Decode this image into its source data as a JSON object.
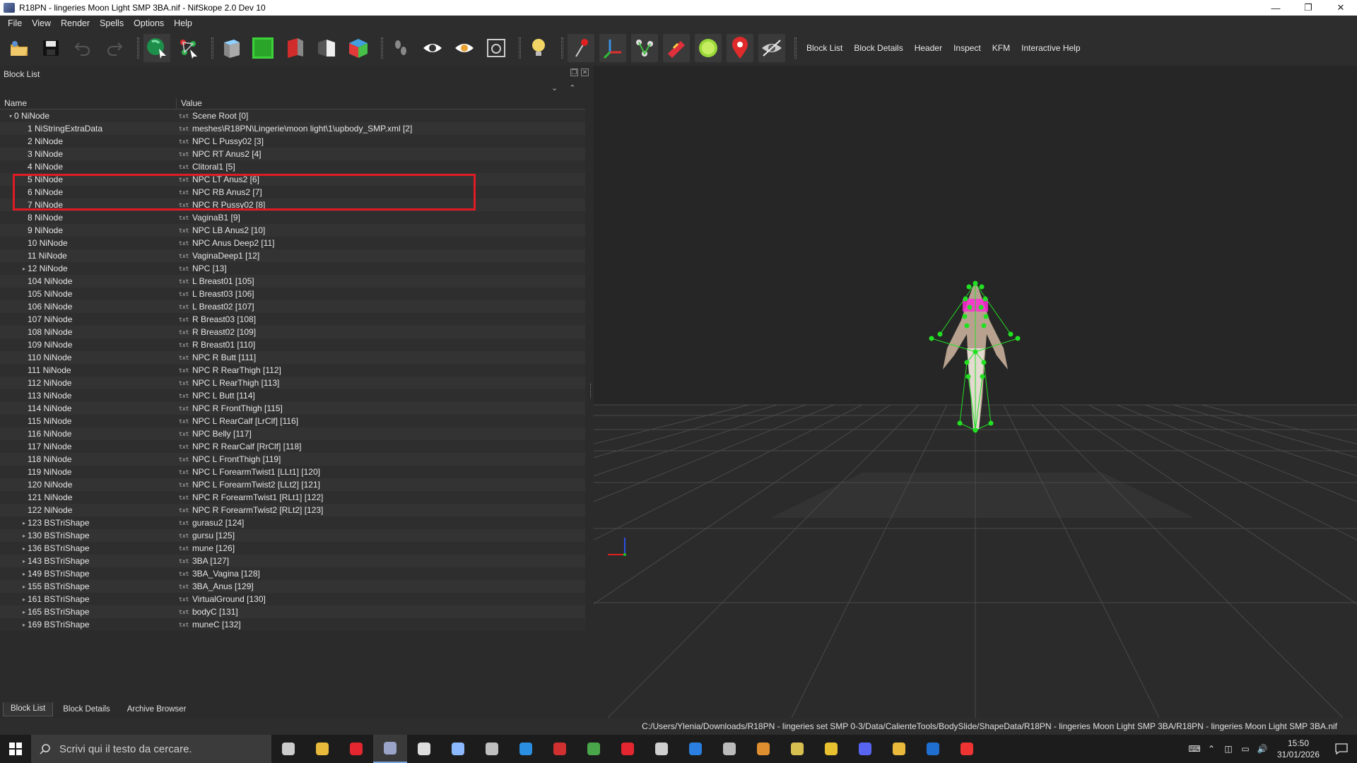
{
  "window": {
    "title": "R18PN - lingeries Moon Light SMP 3BA.nif - NifSkope 2.0 Dev 10",
    "minimize": "—",
    "maximize": "❐",
    "close": "✕"
  },
  "menu": [
    "File",
    "View",
    "Render",
    "Spells",
    "Options",
    "Help"
  ],
  "toolbar": {
    "icons": [
      "load-icon",
      "save-icon",
      "undo-icon",
      "redo-icon",
      "select-object-icon",
      "select-vertex-icon",
      "view-top-icon",
      "view-front-icon",
      "view-side-icon",
      "view-user-icon",
      "view-walk-icon",
      "footprint-icon",
      "show-eye-icon",
      "show-hidden-icon",
      "screenshot-icon",
      "lighting-bulb-icon",
      "show-markers-icon",
      "show-axes-icon",
      "show-nodes-icon",
      "show-constraints-icon",
      "show-havok-icon",
      "show-furniture-icon",
      "show-hidden-objects-icon"
    ],
    "tabs": [
      "Block List",
      "Block Details",
      "Header",
      "Inspect",
      "KFM",
      "Interactive Help"
    ]
  },
  "blocklist": {
    "title": "Block List",
    "columns": {
      "name": "Name",
      "value": "Value"
    },
    "rows": [
      {
        "name": "0 NiNode",
        "value": "Scene Root [0]",
        "expander": "▾",
        "indent": 0
      },
      {
        "name": "1 NiStringExtraData",
        "value": "meshes\\R18PN\\Lingerie\\moon light\\1\\upbody_SMP.xml [2]",
        "expander": "",
        "indent": 1
      },
      {
        "name": "2 NiNode",
        "value": "NPC L Pussy02 [3]",
        "expander": "",
        "indent": 1
      },
      {
        "name": "3 NiNode",
        "value": "NPC RT Anus2 [4]",
        "expander": "",
        "indent": 1
      },
      {
        "name": "4 NiNode",
        "value": "Clitoral1 [5]",
        "expander": "",
        "indent": 1
      },
      {
        "name": "5 NiNode",
        "value": "NPC LT Anus2 [6]",
        "expander": "",
        "indent": 1
      },
      {
        "name": "6 NiNode",
        "value": "NPC RB Anus2 [7]",
        "expander": "",
        "indent": 1
      },
      {
        "name": "7 NiNode",
        "value": "NPC R Pussy02 [8]",
        "expander": "",
        "indent": 1
      },
      {
        "name": "8 NiNode",
        "value": "VaginaB1 [9]",
        "expander": "",
        "indent": 1
      },
      {
        "name": "9 NiNode",
        "value": "NPC LB Anus2 [10]",
        "expander": "",
        "indent": 1
      },
      {
        "name": "10 NiNode",
        "value": "NPC Anus Deep2 [11]",
        "expander": "",
        "indent": 1
      },
      {
        "name": "11 NiNode",
        "value": "VaginaDeep1 [12]",
        "expander": "",
        "indent": 1
      },
      {
        "name": "12 NiNode",
        "value": "NPC [13]",
        "expander": "▸",
        "indent": 1
      },
      {
        "name": "104 NiNode",
        "value": "L Breast01 [105]",
        "expander": "",
        "indent": 1
      },
      {
        "name": "105 NiNode",
        "value": "L Breast03 [106]",
        "expander": "",
        "indent": 1
      },
      {
        "name": "106 NiNode",
        "value": "L Breast02 [107]",
        "expander": "",
        "indent": 1
      },
      {
        "name": "107 NiNode",
        "value": "R Breast03 [108]",
        "expander": "",
        "indent": 1
      },
      {
        "name": "108 NiNode",
        "value": "R Breast02 [109]",
        "expander": "",
        "indent": 1
      },
      {
        "name": "109 NiNode",
        "value": "R Breast01 [110]",
        "expander": "",
        "indent": 1
      },
      {
        "name": "110 NiNode",
        "value": "NPC R Butt [111]",
        "expander": "",
        "indent": 1
      },
      {
        "name": "111 NiNode",
        "value": "NPC R RearThigh [112]",
        "expander": "",
        "indent": 1
      },
      {
        "name": "112 NiNode",
        "value": "NPC L RearThigh [113]",
        "expander": "",
        "indent": 1
      },
      {
        "name": "113 NiNode",
        "value": "NPC L Butt [114]",
        "expander": "",
        "indent": 1
      },
      {
        "name": "114 NiNode",
        "value": "NPC R FrontThigh [115]",
        "expander": "",
        "indent": 1
      },
      {
        "name": "115 NiNode",
        "value": "NPC L RearCalf [LrClf] [116]",
        "expander": "",
        "indent": 1
      },
      {
        "name": "116 NiNode",
        "value": "NPC Belly [117]",
        "expander": "",
        "indent": 1
      },
      {
        "name": "117 NiNode",
        "value": "NPC R RearCalf [RrClf] [118]",
        "expander": "",
        "indent": 1
      },
      {
        "name": "118 NiNode",
        "value": "NPC L FrontThigh [119]",
        "expander": "",
        "indent": 1
      },
      {
        "name": "119 NiNode",
        "value": "NPC L ForearmTwist1 [LLt1] [120]",
        "expander": "",
        "indent": 1
      },
      {
        "name": "120 NiNode",
        "value": "NPC L ForearmTwist2 [LLt2] [121]",
        "expander": "",
        "indent": 1
      },
      {
        "name": "121 NiNode",
        "value": "NPC R ForearmTwist1 [RLt1] [122]",
        "expander": "",
        "indent": 1
      },
      {
        "name": "122 NiNode",
        "value": "NPC R ForearmTwist2 [RLt2] [123]",
        "expander": "",
        "indent": 1
      },
      {
        "name": "123 BSTriShape",
        "value": "gurasu2 [124]",
        "expander": "▸",
        "indent": 1
      },
      {
        "name": "130 BSTriShape",
        "value": "gursu [125]",
        "expander": "▸",
        "indent": 1
      },
      {
        "name": "136 BSTriShape",
        "value": "mune [126]",
        "expander": "▸",
        "indent": 1
      },
      {
        "name": "143 BSTriShape",
        "value": "3BA [127]",
        "expander": "▸",
        "indent": 1
      },
      {
        "name": "149 BSTriShape",
        "value": "3BA_Vagina [128]",
        "expander": "▸",
        "indent": 1
      },
      {
        "name": "155 BSTriShape",
        "value": "3BA_Anus [129]",
        "expander": "▸",
        "indent": 1
      },
      {
        "name": "161 BSTriShape",
        "value": "VirtualGround [130]",
        "expander": "▸",
        "indent": 1
      },
      {
        "name": "165 BSTriShape",
        "value": "bodyC [131]",
        "expander": "▸",
        "indent": 1
      },
      {
        "name": "169 BSTriShape",
        "value": "muneC [132]",
        "expander": "▸",
        "indent": 1
      }
    ],
    "bottom_tabs": [
      "Block List",
      "Block Details",
      "Archive Browser"
    ]
  },
  "statusbar": {
    "path": "C:/Users/Ylenia/Downloads/R18PN - lingeries set SMP 0-3/Data/CalienteTools/BodySlide/ShapeData/R18PN - lingeries Moon Light SMP 3BA/R18PN - lingeries Moon Light SMP 3BA.nif"
  },
  "taskbar": {
    "search_placeholder": "Scrivi qui il testo da cercare.",
    "apps": [
      "task-view-icon",
      "file-explorer-icon",
      "opera-icon",
      "nifskope-icon",
      "terminal-icon",
      "pen-tool-icon",
      "globe-app-icon",
      "store-icon",
      "gear-app-icon",
      "notepad-icon",
      "app-f-icon",
      "arrow-app-icon",
      "window-app-icon",
      "keyboard-app-icon",
      "game-app-icon",
      "folder-app-icon",
      "chrome-icon",
      "discord-icon",
      "sticky-app-icon",
      "blue-app-icon",
      "red-app-icon"
    ],
    "time": "15:50",
    "date": "31/01/2026"
  },
  "colors": {
    "highlight": "#e01b24",
    "bone_green": "#22e022",
    "magenta": "#ff2bd6"
  }
}
